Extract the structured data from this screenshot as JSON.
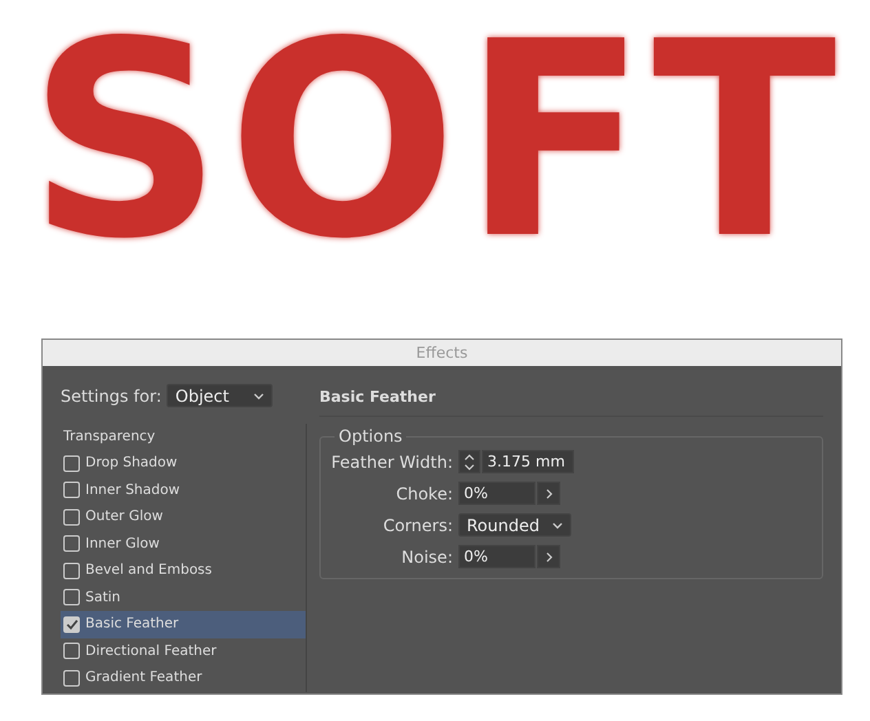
{
  "sample_text": "SOFT",
  "window": {
    "title": "Effects"
  },
  "settings_for": {
    "label": "Settings for:",
    "value": "Object"
  },
  "effects": {
    "heading": "Transparency",
    "items": [
      {
        "label": "Drop Shadow",
        "checked": false,
        "selected": false
      },
      {
        "label": "Inner Shadow",
        "checked": false,
        "selected": false
      },
      {
        "label": "Outer Glow",
        "checked": false,
        "selected": false
      },
      {
        "label": "Inner Glow",
        "checked": false,
        "selected": false
      },
      {
        "label": "Bevel and Emboss",
        "checked": false,
        "selected": false
      },
      {
        "label": "Satin",
        "checked": false,
        "selected": false
      },
      {
        "label": "Basic Feather",
        "checked": true,
        "selected": true
      },
      {
        "label": "Directional Feather",
        "checked": false,
        "selected": false
      },
      {
        "label": "Gradient Feather",
        "checked": false,
        "selected": false
      }
    ]
  },
  "panel": {
    "title": "Basic Feather",
    "group": "Options",
    "fields": [
      {
        "kind": "stepper",
        "label": "Feather Width:",
        "value": "3.175 mm"
      },
      {
        "kind": "slider",
        "label": "Choke:",
        "value": "0%"
      },
      {
        "kind": "dropdown",
        "label": "Corners:",
        "value": "Rounded"
      },
      {
        "kind": "slider",
        "label": "Noise:",
        "value": "0%"
      }
    ]
  }
}
